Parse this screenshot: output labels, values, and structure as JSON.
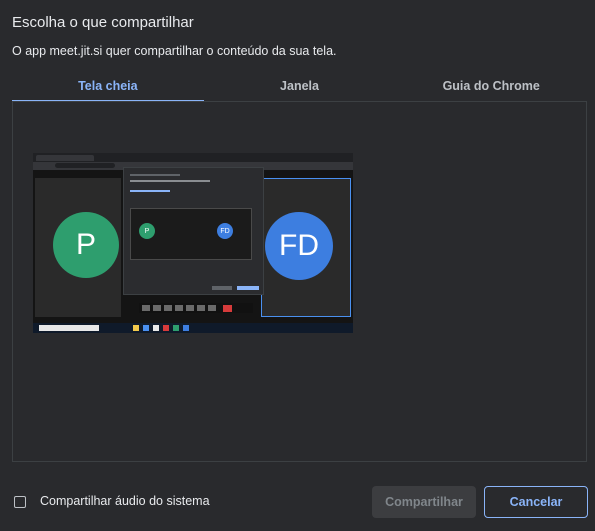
{
  "dialog": {
    "title": "Escolha o que compartilhar",
    "subtitle": "O app meet.jit.si quer compartilhar o conteúdo da sua tela."
  },
  "tabs": [
    {
      "label": "Tela cheia",
      "active": true
    },
    {
      "label": "Janela",
      "active": false
    },
    {
      "label": "Guia do Chrome",
      "active": false
    }
  ],
  "preview": {
    "participants": [
      {
        "initials": "P",
        "color": "#2e9e6e"
      },
      {
        "initials": "FD",
        "color": "#3d7ee0"
      }
    ]
  },
  "footer": {
    "audio_label": "Compartilhar áudio do sistema",
    "audio_checked": false,
    "share_label": "Compartilhar",
    "share_enabled": false,
    "cancel_label": "Cancelar"
  },
  "colors": {
    "background": "#292a2d",
    "accent": "#8ab4f8",
    "text": "#e8eaed"
  }
}
